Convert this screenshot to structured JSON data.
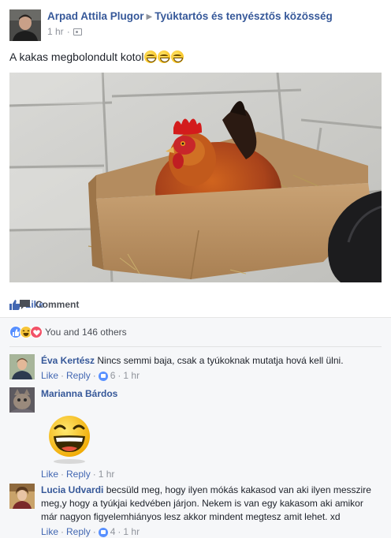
{
  "post": {
    "author": "Arpad Attila Plugor",
    "group": "Tyúktartós és tenyésztős közösség",
    "time": "1 hr",
    "privacy_icon": "group-icon",
    "text": "A kakas megbolondult kotol",
    "emojis": [
      "grinning-squinting-face",
      "grinning-squinting-face",
      "grinning-squinting-face"
    ]
  },
  "actions": {
    "like_label": "Like",
    "comment_label": "Comment"
  },
  "reactions": {
    "icons": [
      "like",
      "haha",
      "love"
    ],
    "summary": "You and 146 others"
  },
  "comments": [
    {
      "name": "Éva Kertész",
      "text": "Nincs semmi baja, csak a tyúkoknak mutatja hová kell ülni.",
      "like_label": "Like",
      "reply_label": "Reply",
      "likes": "6",
      "time": "1 hr"
    },
    {
      "name": "Marianna Bárdos",
      "text": "",
      "sticker": "laughing-emoji-sticker",
      "like_label": "Like",
      "reply_label": "Reply",
      "time": "1 hr"
    },
    {
      "name": "Lucia Udvardi",
      "text": "becsüld meg, hogy ilyen mókás kakasod van aki ilyen messzire meg,y hogy a tyúkjai kedvében járjon. Nekem is van egy kakasom aki amikor már nagyon figyelemhiányos lesz akkor mindent megtesz amit lehet. xd",
      "like_label": "Like",
      "reply_label": "Reply",
      "likes": "4",
      "time": "1 hr"
    }
  ],
  "colors": {
    "link_blue": "#365899",
    "like_blue": "#4267b2",
    "meta_gray": "#90949c",
    "comments_bg": "#f6f7f9"
  }
}
